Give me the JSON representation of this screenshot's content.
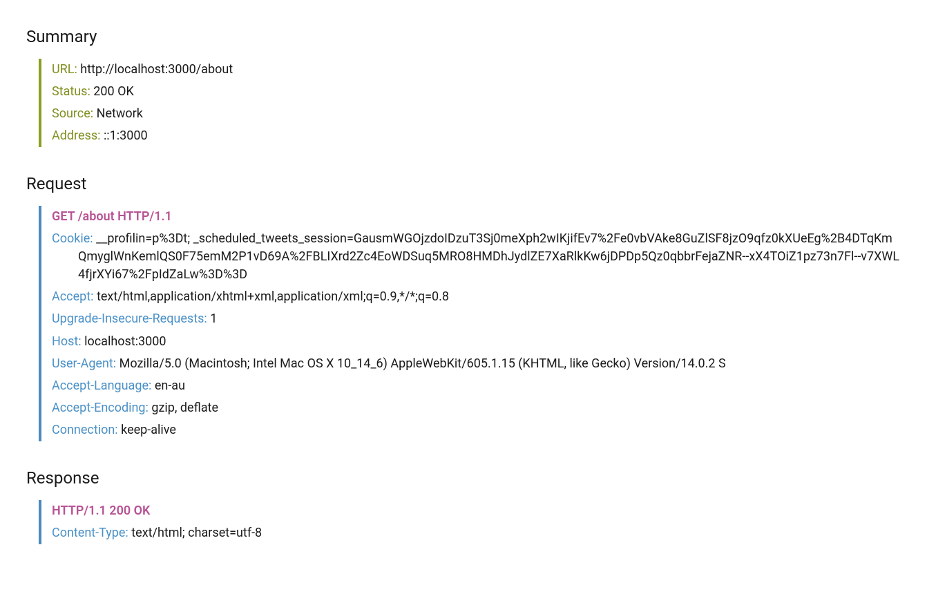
{
  "summary": {
    "title": "Summary",
    "url_label": "URL:",
    "url_value": "http://localhost:3000/about",
    "status_label": "Status:",
    "status_value": "200 OK",
    "source_label": "Source:",
    "source_value": "Network",
    "address_label": "Address:",
    "address_value": "::1:3000"
  },
  "request": {
    "title": "Request",
    "topline": "GET /about HTTP/1.1",
    "headers": [
      {
        "label": "Cookie:",
        "value": "__profilin=p%3Dt; _scheduled_tweets_session=GausmWGOjzdoIDzuT3Sj0meXph2wIKjifEv7%2Fe0vbVAke8GuZlSF8jzO9qfz0kXUeEg%2B4DTqKmQmyglWnKemlQS0F75emM2P1vD69A%2FBLIXrd2Zc4EoWDSuq5MRO8HMDhJydlZE7XaRlkKw6jDPDp5Qz0qbbrFejaZNR--xX4TOiZ1pz73n7Fl--v7XWL4fjrXYi67%2FpIdZaLw%3D%3D"
      },
      {
        "label": "Accept:",
        "value": "text/html,application/xhtml+xml,application/xml;q=0.9,*/*;q=0.8"
      },
      {
        "label": "Upgrade-Insecure-Requests:",
        "value": "1"
      },
      {
        "label": "Host:",
        "value": "localhost:3000"
      },
      {
        "label": "User-Agent:",
        "value": "Mozilla/5.0 (Macintosh; Intel Mac OS X 10_14_6) AppleWebKit/605.1.15 (KHTML, like Gecko) Version/14.0.2 S"
      },
      {
        "label": "Accept-Language:",
        "value": "en-au"
      },
      {
        "label": "Accept-Encoding:",
        "value": "gzip, deflate"
      },
      {
        "label": "Connection:",
        "value": "keep-alive"
      }
    ]
  },
  "response": {
    "title": "Response",
    "topline": "HTTP/1.1 200 OK",
    "headers": [
      {
        "label": "Content-Type:",
        "value": "text/html; charset=utf-8"
      }
    ]
  }
}
